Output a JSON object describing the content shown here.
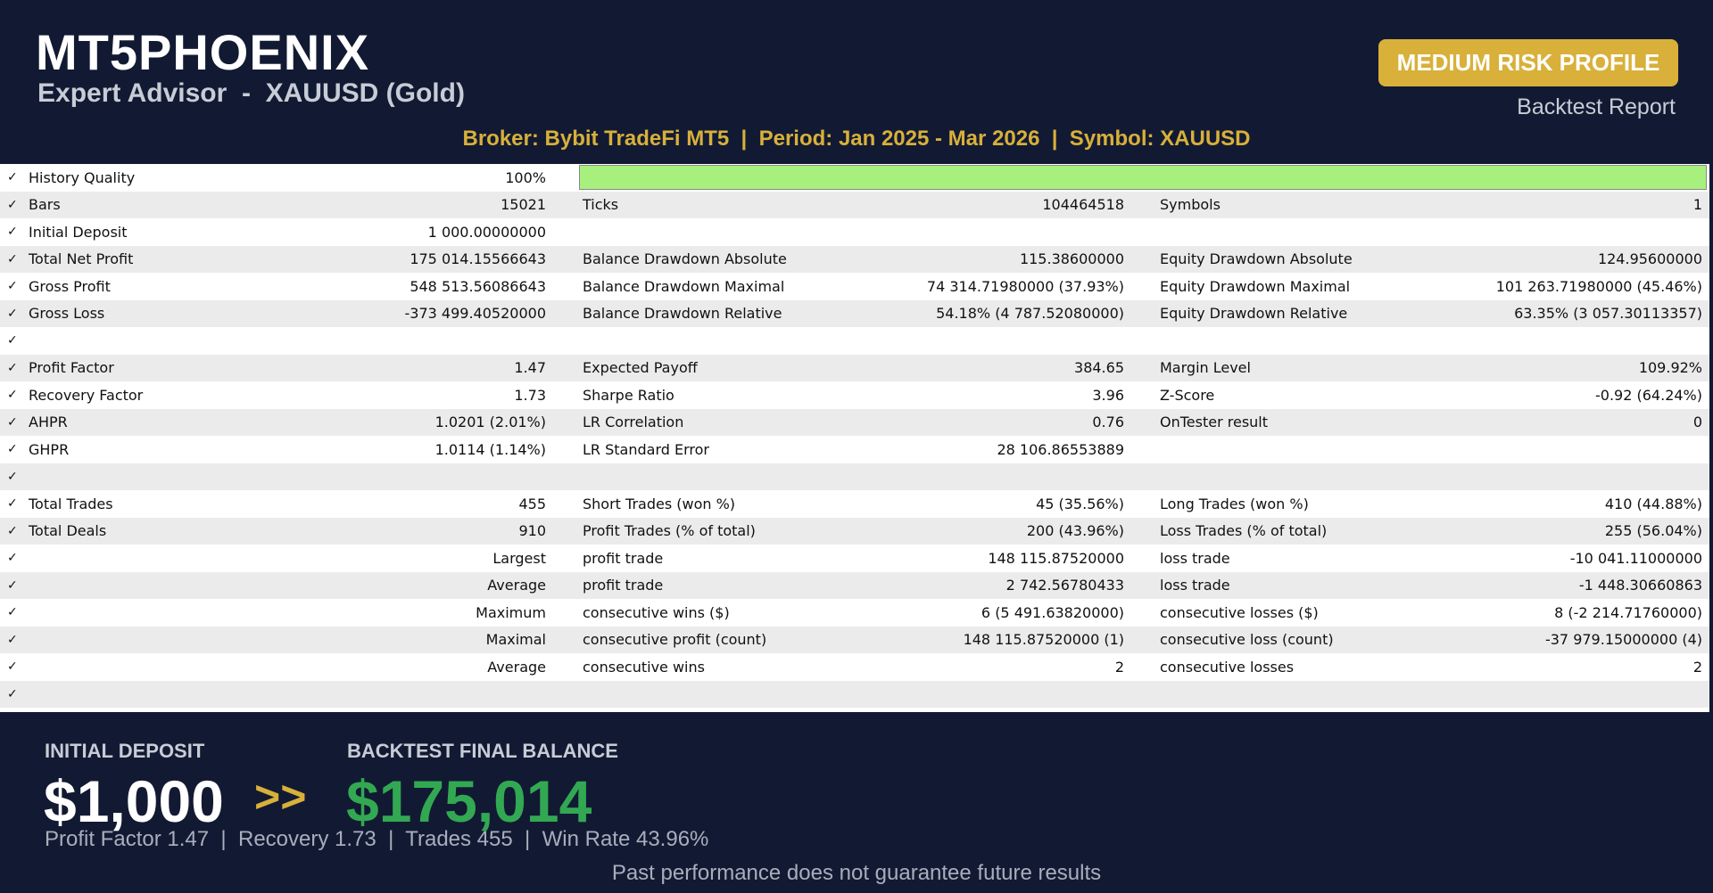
{
  "header": {
    "title": "MT5PHOENIX",
    "subtitle": "Expert Advisor  -  XAUUSD (Gold)",
    "risk_badge": "MEDIUM RISK PROFILE",
    "report_label": "Backtest Report",
    "broker_line": "Broker: Bybit TradeFi MT5  |  Period: Jan 2025 - Mar 2026  |  Symbol: XAUUSD"
  },
  "table": {
    "rows": [
      {
        "c1": "History Quality",
        "v1": "100%",
        "c2": "",
        "v2": "",
        "c3": "",
        "v3": "",
        "quality": 1.0
      },
      {
        "c1": "Bars",
        "v1": "15021",
        "c2": "Ticks",
        "v2": "104464518",
        "c3": "Symbols",
        "v3": "1"
      },
      {
        "c1": "Initial Deposit",
        "v1": "1 000.00000000",
        "c2": "",
        "v2": "",
        "c3": "",
        "v3": ""
      },
      {
        "c1": "Total Net Profit",
        "v1": "175 014.15566643",
        "c2": "Balance Drawdown Absolute",
        "v2": "115.38600000",
        "c3": "Equity Drawdown Absolute",
        "v3": "124.95600000"
      },
      {
        "c1": "Gross Profit",
        "v1": "548 513.56086643",
        "c2": "Balance Drawdown Maximal",
        "v2": "74 314.71980000 (37.93%)",
        "c3": "Equity Drawdown Maximal",
        "v3": "101 263.71980000 (45.46%)"
      },
      {
        "c1": "Gross Loss",
        "v1": "-373 499.40520000",
        "c2": "Balance Drawdown Relative",
        "v2": "54.18% (4 787.52080000)",
        "c3": "Equity Drawdown Relative",
        "v3": "63.35% (3 057.30113357)"
      },
      {
        "c1": "",
        "v1": "",
        "c2": "",
        "v2": "",
        "c3": "",
        "v3": ""
      },
      {
        "c1": "Profit Factor",
        "v1": "1.47",
        "c2": "Expected Payoff",
        "v2": "384.65",
        "c3": "Margin Level",
        "v3": "109.92%"
      },
      {
        "c1": "Recovery Factor",
        "v1": "1.73",
        "c2": "Sharpe Ratio",
        "v2": "3.96",
        "c3": "Z-Score",
        "v3": "-0.92 (64.24%)"
      },
      {
        "c1": "AHPR",
        "v1": "1.0201 (2.01%)",
        "c2": "LR Correlation",
        "v2": "0.76",
        "c3": "OnTester result",
        "v3": "0"
      },
      {
        "c1": "GHPR",
        "v1": "1.0114 (1.14%)",
        "c2": "LR Standard Error",
        "v2": "28 106.86553889",
        "c3": "",
        "v3": ""
      },
      {
        "c1": "",
        "v1": "",
        "c2": "",
        "v2": "",
        "c3": "",
        "v3": ""
      },
      {
        "c1": "Total Trades",
        "v1": "455",
        "c2": "Short Trades (won %)",
        "v2": "45 (35.56%)",
        "c3": "Long Trades (won %)",
        "v3": "410 (44.88%)"
      },
      {
        "c1": "Total Deals",
        "v1": "910",
        "c2": "Profit Trades (% of total)",
        "v2": "200 (43.96%)",
        "c3": "Loss Trades (% of total)",
        "v3": "255 (56.04%)"
      },
      {
        "c1": "",
        "v1": "Largest",
        "c2": "profit trade",
        "v2": "148 115.87520000",
        "c3": "loss trade",
        "v3": "-10 041.11000000"
      },
      {
        "c1": "",
        "v1": "Average",
        "c2": "profit trade",
        "v2": "2 742.56780433",
        "c3": "loss trade",
        "v3": "-1 448.30660863"
      },
      {
        "c1": "",
        "v1": "Maximum",
        "c2": "consecutive wins ($)",
        "v2": "6 (5 491.63820000)",
        "c3": "consecutive losses ($)",
        "v3": "8 (-2 214.71760000)"
      },
      {
        "c1": "",
        "v1": "Maximal",
        "c2": "consecutive profit (count)",
        "v2": "148 115.87520000 (1)",
        "c3": "consecutive loss (count)",
        "v3": "-37 979.15000000 (4)"
      },
      {
        "c1": "",
        "v1": "Average",
        "c2": "consecutive wins",
        "v2": "2",
        "c3": "consecutive losses",
        "v3": "2"
      },
      {
        "c1": "",
        "v1": "",
        "c2": "",
        "v2": "",
        "c3": "",
        "v3": ""
      }
    ],
    "check_glyph": "✓",
    "quality_bar_color": "#a8f07e"
  },
  "footer": {
    "initial_label": "INITIAL DEPOSIT",
    "final_label": "BACKTEST FINAL BALANCE",
    "initial_value": "$1,000",
    "arrows": ">>",
    "final_value": "$175,014",
    "stats_line": "Profit Factor 1.47  |  Recovery 1.73  |  Trades 455  |  Win Rate 43.96%",
    "disclaimer": "Past performance does not guarantee future results"
  },
  "colors": {
    "background": "#121a33",
    "accent_gold": "#d8b03a",
    "final_green": "#32a852"
  }
}
